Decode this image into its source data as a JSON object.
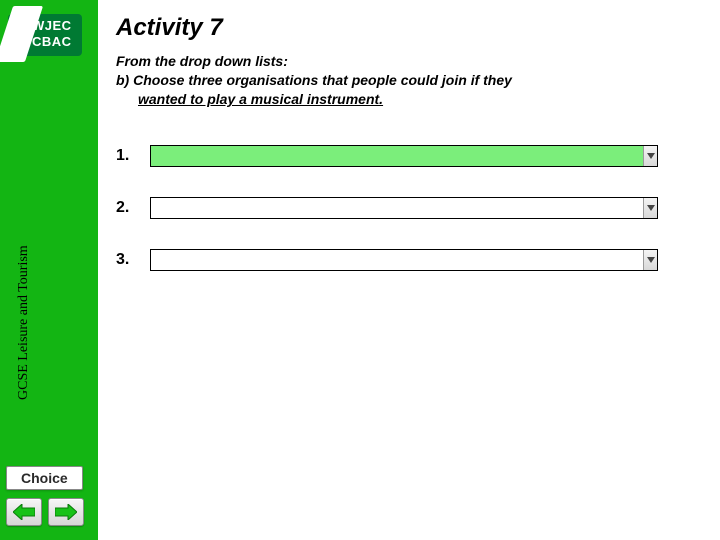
{
  "brand": {
    "logo_line1": "WJEC",
    "logo_line2": "CBAC",
    "vertical_label": "GCSE Leisure and Tourism"
  },
  "activity": {
    "title": "Activity 7",
    "instruction_line1": "From the drop down lists:",
    "instruction_line2": "b)   Choose three organisations that people could join if they",
    "instruction_line3": "wanted to play a musical instrument.",
    "questions": [
      {
        "num": "1.",
        "value": "",
        "highlighted": true
      },
      {
        "num": "2.",
        "value": "",
        "highlighted": false
      },
      {
        "num": "3.",
        "value": "",
        "highlighted": false
      }
    ]
  },
  "nav": {
    "choice_label": "Choice"
  },
  "colors": {
    "sidebar": "#13b513",
    "highlight": "#7bee7b",
    "logo_box": "#007a33"
  }
}
